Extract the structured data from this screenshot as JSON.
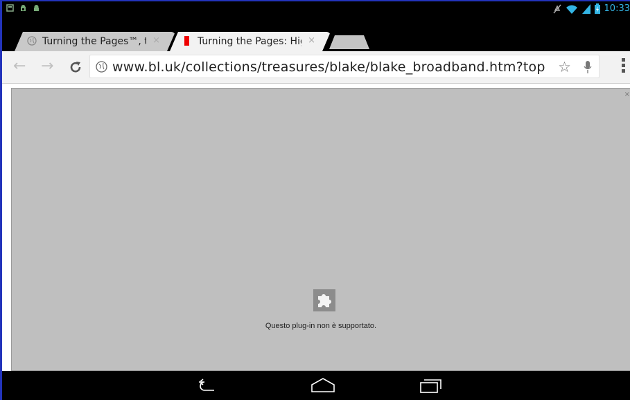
{
  "status_bar": {
    "time": "10:33",
    "left_icons": [
      "notification-icon",
      "android-debug-icon",
      "android-icon"
    ],
    "right_icons": [
      "mute-icon",
      "wifi-icon",
      "signal-icon",
      "battery-icon"
    ]
  },
  "tabs": [
    {
      "title": "Turning the Pages™, the",
      "active": false,
      "close": "×"
    },
    {
      "title": "Turning the Pages: High",
      "active": true,
      "close": "×"
    }
  ],
  "toolbar": {
    "url": "www.bl.uk/collections/treasures/blake/blake_broadband.htm?top"
  },
  "content": {
    "plugin_message": "Questo plug-in non è supportato.",
    "close_label": "×"
  },
  "colors": {
    "accent": "#33b5e5",
    "plugin_bg": "#bfbfbf",
    "tab_active": "#f2f2f2",
    "tab_inactive": "#c9c9c9"
  }
}
